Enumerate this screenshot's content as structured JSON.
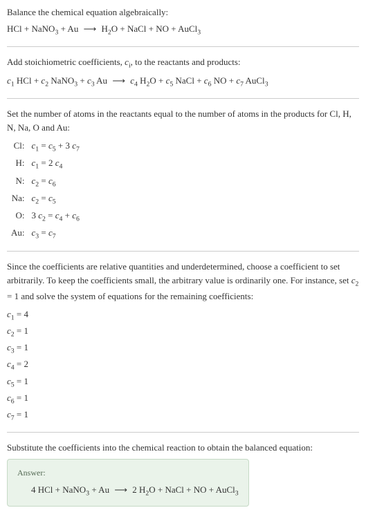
{
  "section1": {
    "title": "Balance the chemical equation algebraically:",
    "equation_parts": {
      "lhs": [
        {
          "formula": "HCl",
          "sub": ""
        },
        {
          "formula": "NaNO",
          "sub": "3"
        },
        {
          "formula": "Au",
          "sub": ""
        }
      ],
      "rhs": [
        {
          "formula": "H",
          "sub": "2",
          "suffix": "O"
        },
        {
          "formula": "NaCl",
          "sub": ""
        },
        {
          "formula": "NO",
          "sub": ""
        },
        {
          "formula": "AuCl",
          "sub": "3"
        }
      ]
    }
  },
  "section2": {
    "title_pre": "Add stoichiometric coefficients, ",
    "title_var": "c",
    "title_sub": "i",
    "title_post": ", to the reactants and products:"
  },
  "section3": {
    "title": "Set the number of atoms in the reactants equal to the number of atoms in the products for Cl, H, N, Na, O and Au:",
    "rows": [
      {
        "label": "Cl:",
        "eq_parts": [
          "c",
          "1",
          " = ",
          "c",
          "5",
          " + 3 ",
          "c",
          "7"
        ]
      },
      {
        "label": "H:",
        "eq_parts": [
          "c",
          "1",
          " = 2 ",
          "c",
          "4"
        ]
      },
      {
        "label": "N:",
        "eq_parts": [
          "c",
          "2",
          " = ",
          "c",
          "6"
        ]
      },
      {
        "label": "Na:",
        "eq_parts": [
          "c",
          "2",
          " = ",
          "c",
          "5"
        ]
      },
      {
        "label": "O:",
        "eq_parts_special": "3c2_eq_c4_plus_c6"
      },
      {
        "label": "Au:",
        "eq_parts": [
          "c",
          "3",
          " = ",
          "c",
          "7"
        ]
      }
    ]
  },
  "section4": {
    "title_pre": "Since the coefficients are relative quantities and underdetermined, choose a coefficient to set arbitrarily. To keep the coefficients small, the arbitrary value is ordinarily one. For instance, set ",
    "title_mid_var": "c",
    "title_mid_sub": "2",
    "title_post": " = 1 and solve the system of equations for the remaining coefficients:",
    "coeffs": [
      {
        "var": "c",
        "sub": "1",
        "val": " = 4"
      },
      {
        "var": "c",
        "sub": "2",
        "val": " = 1"
      },
      {
        "var": "c",
        "sub": "3",
        "val": " = 1"
      },
      {
        "var": "c",
        "sub": "4",
        "val": " = 2"
      },
      {
        "var": "c",
        "sub": "5",
        "val": " = 1"
      },
      {
        "var": "c",
        "sub": "6",
        "val": " = 1"
      },
      {
        "var": "c",
        "sub": "7",
        "val": " = 1"
      }
    ]
  },
  "section5": {
    "title": "Substitute the coefficients into the chemical reaction to obtain the balanced equation:"
  },
  "answer": {
    "label": "Answer:",
    "coeffs": {
      "hcl": "4",
      "h2o": "2"
    }
  },
  "arrow": "⟶",
  "plus": " + "
}
